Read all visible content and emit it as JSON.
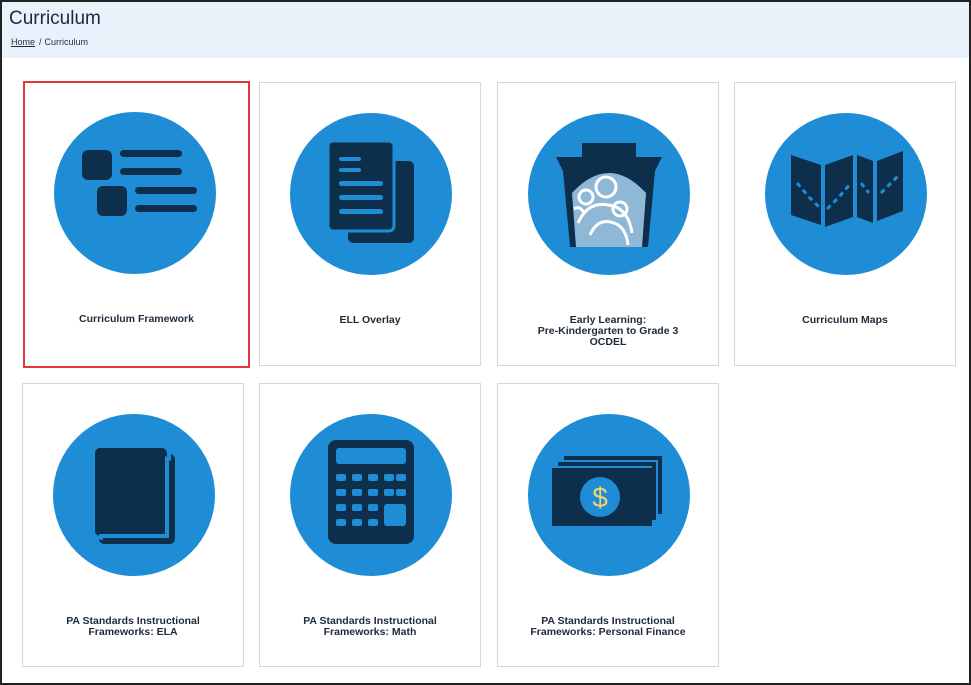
{
  "header": {
    "title": "Curriculum",
    "breadcrumb": {
      "home": "Home",
      "separator": "/",
      "current": "Curriculum"
    }
  },
  "colors": {
    "header_bg": "#e9f2fb",
    "circle_blue": "#1f8dd6",
    "icon_navy": "#0d2f4b",
    "selected_border": "#e0373c",
    "dollar_yellow": "#f3d26b"
  },
  "cards": [
    {
      "icon": "curriculum-framework-icon",
      "lines": [
        "Curriculum Framework"
      ],
      "selected": true
    },
    {
      "icon": "documents-icon",
      "lines": [
        "ELL Overlay"
      ],
      "selected": false
    },
    {
      "icon": "keystone-family-icon",
      "lines": [
        "Early Learning:",
        "Pre-Kindergarten to Grade 3",
        "OCDEL"
      ],
      "selected": false
    },
    {
      "icon": "map-icon",
      "lines": [
        "Curriculum Maps"
      ],
      "selected": false
    },
    {
      "icon": "book-icon",
      "lines": [
        "PA Standards Instructional",
        "Frameworks: ELA"
      ],
      "selected": false
    },
    {
      "icon": "calculator-icon",
      "lines": [
        "PA Standards Instructional",
        "Frameworks: Math"
      ],
      "selected": false
    },
    {
      "icon": "money-icon",
      "lines": [
        "PA Standards Instructional",
        "Frameworks: Personal Finance"
      ],
      "selected": false
    }
  ]
}
